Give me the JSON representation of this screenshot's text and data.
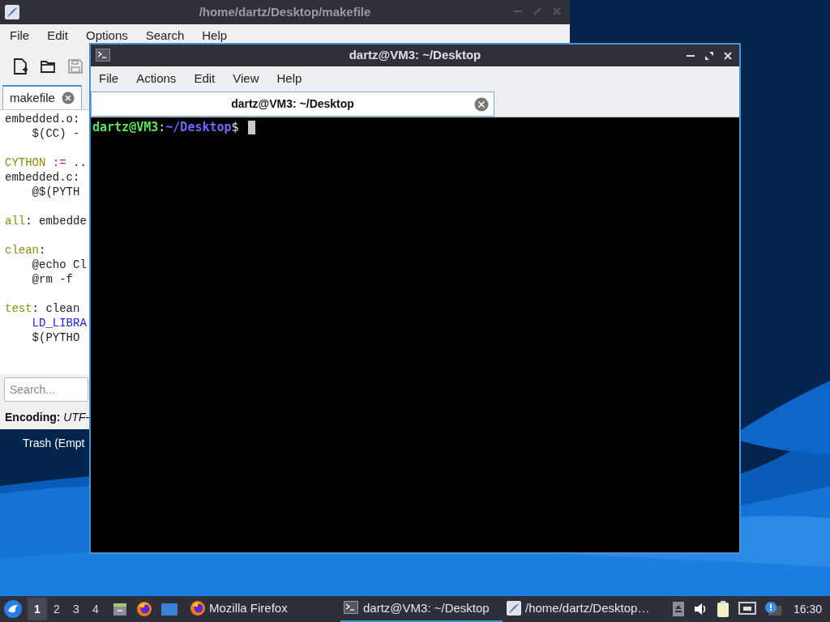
{
  "desktop": {
    "icons": [
      {
        "label": "Trash (Empt"
      }
    ]
  },
  "editor": {
    "title": "/home/dartz/Desktop/makefile",
    "menu": [
      "File",
      "Edit",
      "Options",
      "Search",
      "Help"
    ],
    "tabs": [
      {
        "label": "makefile",
        "selected": true
      }
    ],
    "blocks": [
      [
        [
          {
            "text": "embedded.o:",
            "kind": "plain"
          }
        ],
        [
          {
            "text": "    $(CC) -",
            "kind": "plain"
          }
        ]
      ],
      [
        [
          {
            "text": "CYTHON",
            "kind": "keyword"
          },
          {
            "text": " :=",
            "kind": "operator"
          },
          {
            "text": " ..",
            "kind": "plain"
          }
        ],
        [
          {
            "text": "embedded.c:",
            "kind": "plain"
          }
        ],
        [
          {
            "text": "    @$(PYTH",
            "kind": "plain"
          }
        ]
      ],
      [
        [
          {
            "text": "all",
            "kind": "keyword"
          },
          {
            "text": ": embedde",
            "kind": "plain"
          }
        ]
      ],
      [
        [
          {
            "text": "clean",
            "kind": "keyword"
          },
          {
            "text": ":",
            "kind": "plain"
          }
        ],
        [
          {
            "text": "    @echo Cl",
            "kind": "plain"
          }
        ],
        [
          {
            "text": "    @rm -f",
            "kind": "plain"
          }
        ]
      ],
      [
        [
          {
            "text": "test",
            "kind": "keyword"
          },
          {
            "text": ": clean",
            "kind": "plain"
          }
        ],
        [
          {
            "text": "    LD_LIBRA",
            "kind": "variable"
          }
        ],
        [
          {
            "text": "    $(PYTHO",
            "kind": "plain"
          }
        ]
      ]
    ],
    "search": {
      "placeholder": "Search..."
    },
    "status": "**Encoding:** *UTF-*"
  },
  "terminal": {
    "title": "dartz@VM3: ~/Desktop",
    "menu": [
      "File",
      "Actions",
      "Edit",
      "View",
      "Help"
    ],
    "tabs": [
      {
        "label": "dartz@VM3: ~/Desktop",
        "selected": true
      }
    ],
    "prompt": [
      {
        "text": "dartz@VM3",
        "kind": "user"
      },
      {
        "text": ":",
        "kind": "plain"
      },
      {
        "text": "~/Desktop",
        "kind": "path"
      },
      {
        "text": "$",
        "kind": "plain"
      }
    ]
  },
  "taskbar": {
    "workspaces": [
      {
        "label": "1",
        "selected": true
      },
      {
        "label": "2",
        "selected": false
      },
      {
        "label": "3",
        "selected": false
      },
      {
        "label": "4",
        "selected": false
      }
    ],
    "tasks": [
      {
        "label": "Mozilla Firefox",
        "kind": "firefox",
        "selected": false
      },
      {
        "label": "dartz@VM3: ~/Desktop",
        "kind": "terminal",
        "selected": true
      },
      {
        "label": "/home/dartz/Desktop…",
        "kind": "editor",
        "selected": false
      }
    ],
    "clock": "16:30"
  }
}
